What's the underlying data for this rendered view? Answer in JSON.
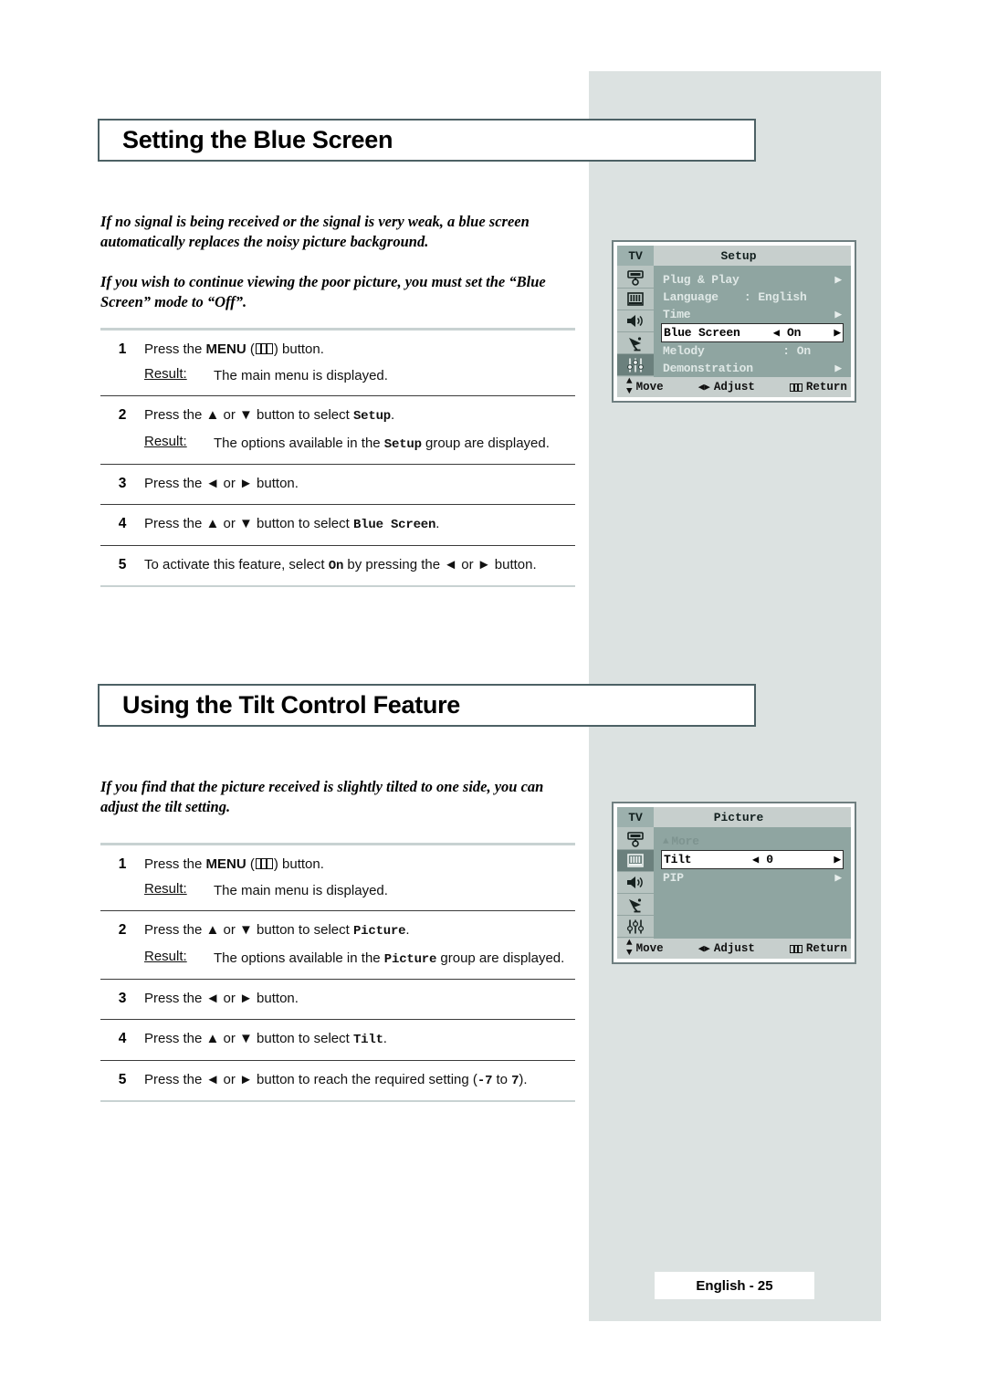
{
  "page": {
    "footer_label": "English - 25",
    "accent_border": "#4d6165",
    "panel_bg": "#dce2e1",
    "osd_bg": "#8fa5a1",
    "osd_bar": "#c7cfcd"
  },
  "sections": [
    {
      "title": "Setting the Blue Screen",
      "intro": [
        "If no signal is being received or the signal is very weak, a blue screen automatically replaces the noisy picture background.",
        "If you wish to continue viewing the poor picture, you must set the “Blue Screen” mode to “Off”."
      ],
      "steps": [
        {
          "num": "1",
          "text_pre": "Press the ",
          "text_bold": "MENU",
          "text_post": " button.",
          "result_label": "Result:",
          "result_pre": "The main menu is displayed.",
          "result_mono": "",
          "result_post": ""
        },
        {
          "num": "2",
          "text_pre": "Press the ▲ or ▼ button to select ",
          "text_mono": "Setup",
          "text_post": ".",
          "result_label": "Result:",
          "result_pre": "The options available in the ",
          "result_mono": "Setup",
          "result_post": " group are displayed."
        },
        {
          "num": "3",
          "text_pre": "Press the ◄ or ► button."
        },
        {
          "num": "4",
          "text_pre": "Press the ▲ or ▼ button to select ",
          "text_mono": "Blue Screen",
          "text_post": "."
        },
        {
          "num": "5",
          "text_pre": "To activate this feature, select ",
          "text_mono": "On",
          "text_post": " by pressing the ◄ or ► button."
        }
      ]
    },
    {
      "title": "Using the Tilt Control Feature",
      "intro": [
        "If you find that the picture received is slightly tilted to one side, you can adjust the tilt setting."
      ],
      "steps": [
        {
          "num": "1",
          "text_pre": "Press the ",
          "text_bold": "MENU",
          "text_post": " button.",
          "result_label": "Result:",
          "result_pre": "The main menu is displayed.",
          "result_mono": "",
          "result_post": ""
        },
        {
          "num": "2",
          "text_pre": "Press the ▲ or ▼ button to select ",
          "text_mono": "Picture",
          "text_post": ".",
          "result_label": "Result:",
          "result_pre": "The options available in the ",
          "result_mono": "Picture",
          "result_post": " group are displayed."
        },
        {
          "num": "3",
          "text_pre": "Press the ◄ or ► button."
        },
        {
          "num": "4",
          "text_pre": "Press the ▲ or ▼ button to select ",
          "text_mono": "Tilt",
          "text_post": "."
        },
        {
          "num": "5",
          "text_pre": "Press the ◄ or ► button to reach the required setting (",
          "text_mono": "-7",
          "text_mid": " to ",
          "text_mono2": "7",
          "text_post": ")."
        }
      ]
    }
  ],
  "osd_setup": {
    "source_label": "TV",
    "title": "Setup",
    "rail_icons": [
      "plug-play-icon",
      "picture-bars-icon",
      "speaker-icon",
      "satellite-dish-icon",
      "sliders-icon"
    ],
    "active_rail_index": 4,
    "rows": [
      {
        "label": "Plug & Play",
        "value": "",
        "separator": "",
        "right_arrow": "▶",
        "highlight": false
      },
      {
        "label": "Language",
        "value": "English",
        "separator": ":",
        "right_arrow": "",
        "highlight": false
      },
      {
        "label": "Time",
        "value": "",
        "separator": "",
        "right_arrow": "▶",
        "highlight": false
      },
      {
        "label": "Blue Screen",
        "value": "On",
        "separator": "",
        "left_arrow": "◀",
        "right_arrow": "▶",
        "highlight": true
      },
      {
        "label": "Melody",
        "value": "On",
        "separator": ":",
        "right_arrow": "",
        "highlight": false
      },
      {
        "label": "Demonstration",
        "value": "",
        "separator": "",
        "right_arrow": "▶",
        "highlight": false
      }
    ],
    "footer": {
      "move": "Move",
      "adjust": "Adjust",
      "return": "Return"
    }
  },
  "osd_picture": {
    "source_label": "TV",
    "title": "Picture",
    "rail_icons": [
      "plug-play-icon",
      "picture-bars-icon",
      "speaker-icon",
      "satellite-dish-icon",
      "sliders-icon"
    ],
    "active_rail_index": 1,
    "rows": [
      {
        "label": "More",
        "value": "",
        "more_triangle": "▲",
        "right_arrow": "",
        "highlight": false,
        "dim": true
      },
      {
        "label": "Tilt",
        "value": "0",
        "left_arrow": "◀",
        "right_arrow": "▶",
        "highlight": true
      },
      {
        "label": "PIP",
        "value": "",
        "right_arrow": "▶",
        "highlight": false
      }
    ],
    "footer": {
      "move": "Move",
      "adjust": "Adjust",
      "return": "Return"
    }
  }
}
